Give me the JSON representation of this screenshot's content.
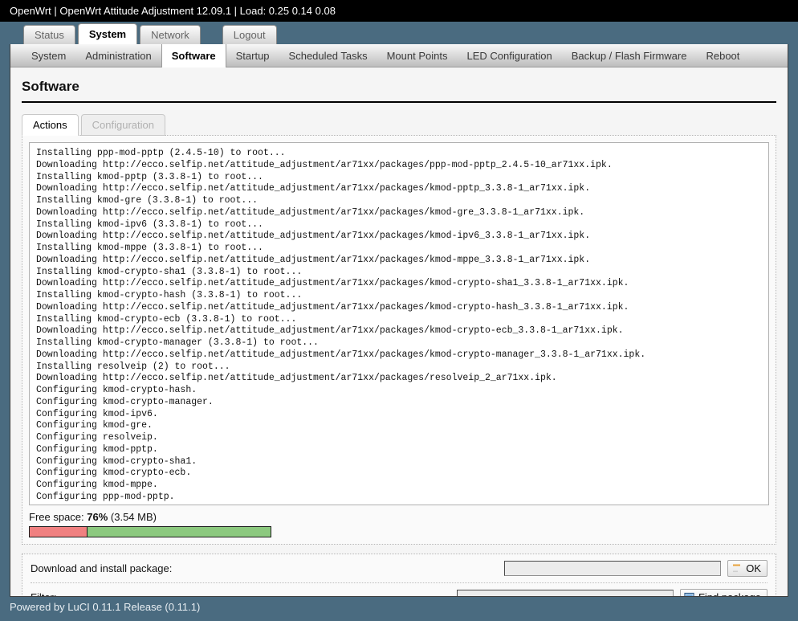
{
  "header": {
    "title": "OpenWrt | OpenWrt Attitude Adjustment 12.09.1 | Load: 0.25 0.14 0.08"
  },
  "mainnav": {
    "items": [
      {
        "label": "Status",
        "active": false
      },
      {
        "label": "System",
        "active": true
      },
      {
        "label": "Network",
        "active": false
      },
      {
        "label": "Logout",
        "active": false
      }
    ]
  },
  "subnav": {
    "items": [
      {
        "label": "System",
        "active": false
      },
      {
        "label": "Administration",
        "active": false
      },
      {
        "label": "Software",
        "active": true
      },
      {
        "label": "Startup",
        "active": false
      },
      {
        "label": "Scheduled Tasks",
        "active": false
      },
      {
        "label": "Mount Points",
        "active": false
      },
      {
        "label": "LED Configuration",
        "active": false
      },
      {
        "label": "Backup / Flash Firmware",
        "active": false
      },
      {
        "label": "Reboot",
        "active": false
      }
    ]
  },
  "page": {
    "title": "Software"
  },
  "innertabs": {
    "items": [
      {
        "label": "Actions",
        "active": true,
        "disabled": false
      },
      {
        "label": "Configuration",
        "active": false,
        "disabled": true
      }
    ]
  },
  "log": {
    "text": "Installing ppp-mod-pptp (2.4.5-10) to root...\nDownloading http://ecco.selfip.net/attitude_adjustment/ar71xx/packages/ppp-mod-pptp_2.4.5-10_ar71xx.ipk.\nInstalling kmod-pptp (3.3.8-1) to root...\nDownloading http://ecco.selfip.net/attitude_adjustment/ar71xx/packages/kmod-pptp_3.3.8-1_ar71xx.ipk.\nInstalling kmod-gre (3.3.8-1) to root...\nDownloading http://ecco.selfip.net/attitude_adjustment/ar71xx/packages/kmod-gre_3.3.8-1_ar71xx.ipk.\nInstalling kmod-ipv6 (3.3.8-1) to root...\nDownloading http://ecco.selfip.net/attitude_adjustment/ar71xx/packages/kmod-ipv6_3.3.8-1_ar71xx.ipk.\nInstalling kmod-mppe (3.3.8-1) to root...\nDownloading http://ecco.selfip.net/attitude_adjustment/ar71xx/packages/kmod-mppe_3.3.8-1_ar71xx.ipk.\nInstalling kmod-crypto-sha1 (3.3.8-1) to root...\nDownloading http://ecco.selfip.net/attitude_adjustment/ar71xx/packages/kmod-crypto-sha1_3.3.8-1_ar71xx.ipk.\nInstalling kmod-crypto-hash (3.3.8-1) to root...\nDownloading http://ecco.selfip.net/attitude_adjustment/ar71xx/packages/kmod-crypto-hash_3.3.8-1_ar71xx.ipk.\nInstalling kmod-crypto-ecb (3.3.8-1) to root...\nDownloading http://ecco.selfip.net/attitude_adjustment/ar71xx/packages/kmod-crypto-ecb_3.3.8-1_ar71xx.ipk.\nInstalling kmod-crypto-manager (3.3.8-1) to root...\nDownloading http://ecco.selfip.net/attitude_adjustment/ar71xx/packages/kmod-crypto-manager_3.3.8-1_ar71xx.ipk.\nInstalling resolveip (2) to root...\nDownloading http://ecco.selfip.net/attitude_adjustment/ar71xx/packages/resolveip_2_ar71xx.ipk.\nConfiguring kmod-crypto-hash.\nConfiguring kmod-crypto-manager.\nConfiguring kmod-ipv6.\nConfiguring kmod-gre.\nConfiguring resolveip.\nConfiguring kmod-pptp.\nConfiguring kmod-crypto-sha1.\nConfiguring kmod-crypto-ecb.\nConfiguring kmod-mppe.\nConfiguring ppp-mod-pptp."
  },
  "freespace": {
    "prefix": "Free space: ",
    "percent_text": "76%",
    "size_text": " (3.54 MB)",
    "free_percent": 76,
    "used_percent": 24,
    "used_color": "#f08080",
    "free_color": "#8cc97f"
  },
  "form": {
    "download": {
      "label": "Download and install package:",
      "value": "",
      "placeholder": "",
      "button_label": "OK",
      "button_icon": "apply-icon"
    },
    "filter": {
      "label": "Filter:",
      "value": "",
      "placeholder": "",
      "button_label": "Find package",
      "button_icon": "find-icon"
    }
  },
  "footer": {
    "text": "Powered by LuCI 0.11.1 Release (0.11.1)"
  }
}
